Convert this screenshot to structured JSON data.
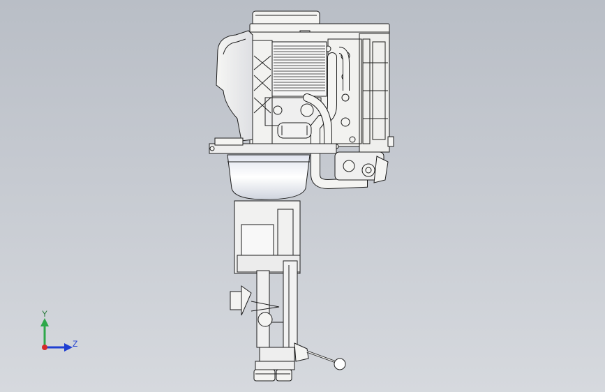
{
  "viewport": {
    "background_top": "#b9bec6",
    "background_bottom": "#d6d9de"
  },
  "triad": {
    "y_label": "Y",
    "z_label": "Z",
    "y_color": "#2ea84a",
    "z_color": "#1f3fd1",
    "x_color": "#d42a2a"
  },
  "model": {
    "line_color": "#1c1c1c",
    "fill_color": "#f4f4f2",
    "shade_color": "#dfe3ea"
  }
}
